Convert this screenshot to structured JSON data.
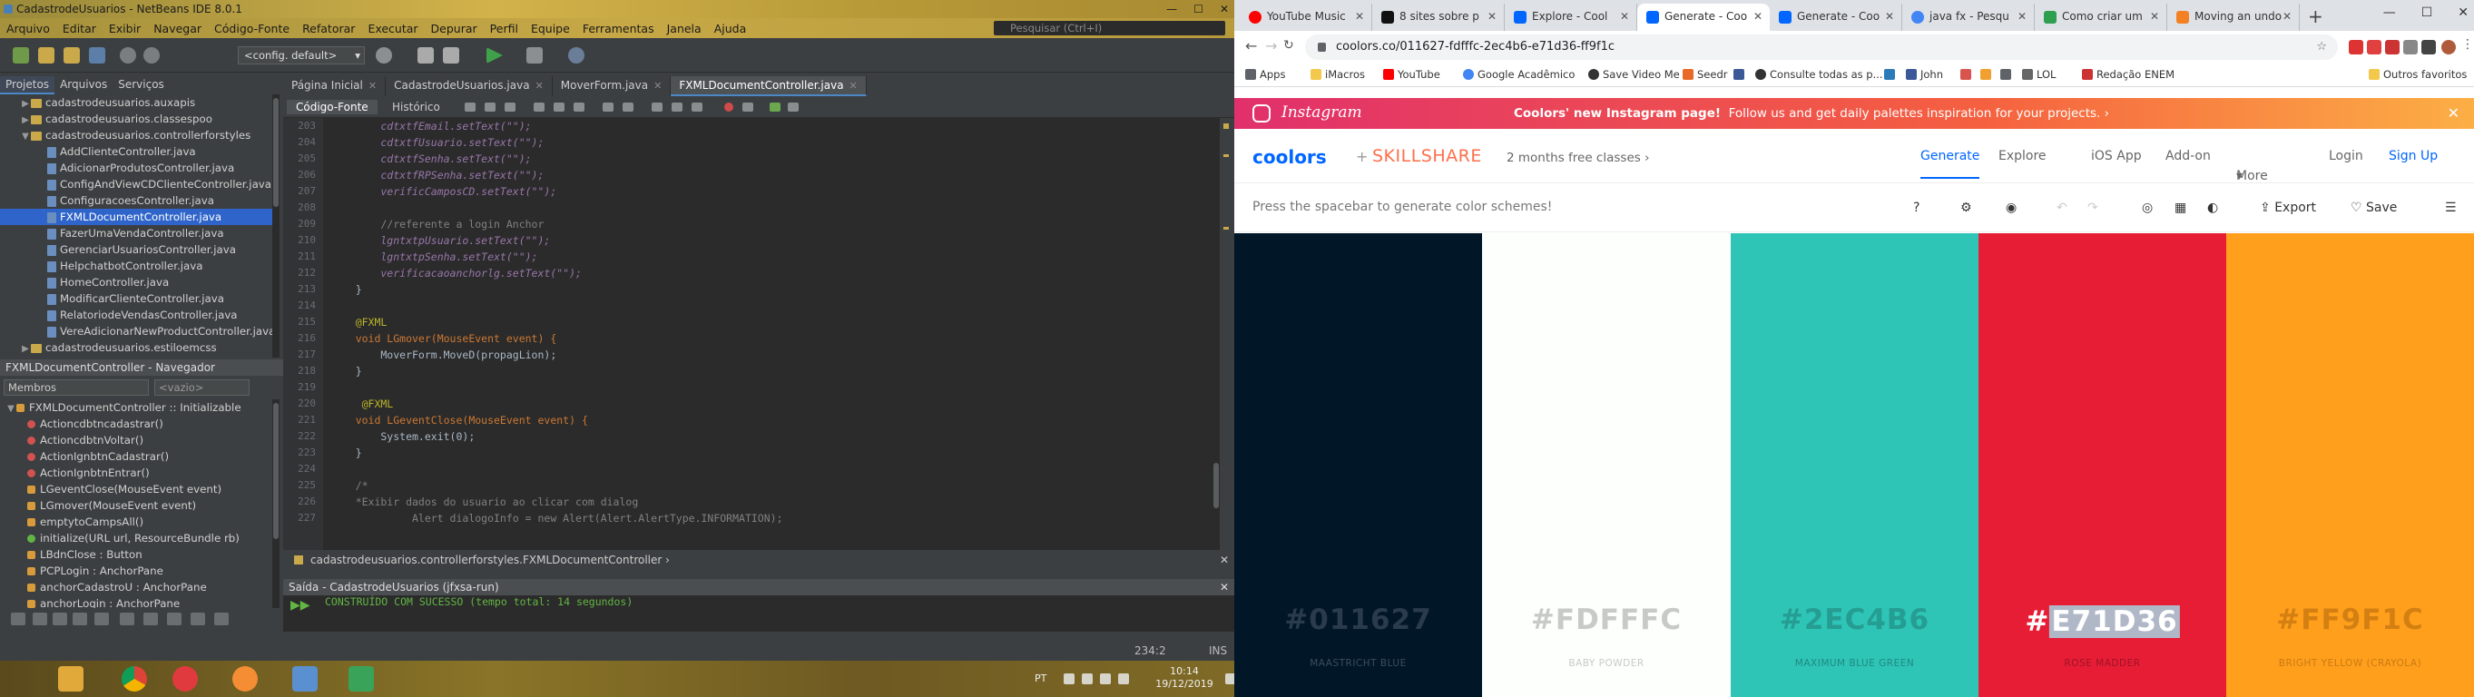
{
  "netbeans": {
    "title": "CadastrodeUsuarios - NetBeans IDE 8.0.1",
    "window_buttons": [
      "—",
      "☐",
      "✕"
    ],
    "menu": [
      "Arquivo",
      "Editar",
      "Exibir",
      "Navegar",
      "Código-Fonte",
      "Refatorar",
      "Executar",
      "Depurar",
      "Perfil",
      "Equipe",
      "Ferramentas",
      "Janela",
      "Ajuda"
    ],
    "search_placeholder": "Pesquisar (Ctrl+I)",
    "config": "<config. default>",
    "project_tabs": [
      "Projetos",
      "Arquivos",
      "Serviços"
    ],
    "project_tree": [
      {
        "label": "cadastrodeusuarios.auxapis",
        "kind": "package"
      },
      {
        "label": "cadastrodeusuarios.classespoo",
        "kind": "package"
      },
      {
        "label": "cadastrodeusuarios.controllerforstyles",
        "kind": "package"
      },
      {
        "label": "AddClienteController.java",
        "kind": "file"
      },
      {
        "label": "AdicionarProdutosController.java",
        "kind": "file"
      },
      {
        "label": "ConfigAndViewCDClienteController.java",
        "kind": "file"
      },
      {
        "label": "ConfiguracoesController.java",
        "kind": "file"
      },
      {
        "label": "FXMLDocumentController.java",
        "kind": "file"
      },
      {
        "label": "FazerUmaVendaController.java",
        "kind": "file"
      },
      {
        "label": "GerenciarUsuariosController.java",
        "kind": "file"
      },
      {
        "label": "HelpchatbotController.java",
        "kind": "file"
      },
      {
        "label": "HomeController.java",
        "kind": "file"
      },
      {
        "label": "ModificarClienteController.java",
        "kind": "file"
      },
      {
        "label": "RelatoriodeVendasController.java",
        "kind": "file"
      },
      {
        "label": "VereAdicionarNewProductController.java",
        "kind": "file"
      },
      {
        "label": "cadastrodeusuarios.estiloemcss",
        "kind": "package"
      }
    ],
    "navigator_title": "FXMLDocumentController - Navegador",
    "navigator_members": "Membros",
    "navigator_filter": "<vazio>",
    "navigator_items": [
      {
        "label": "FXMLDocumentController :: Initializable",
        "kind": "class"
      },
      {
        "label": "Actioncdbtncadastrar()",
        "kind": "private"
      },
      {
        "label": "ActioncdbtnVoltar()",
        "kind": "private"
      },
      {
        "label": "ActionIgnbtnCadastrar()",
        "kind": "private"
      },
      {
        "label": "ActionIgnbtnEntrar()",
        "kind": "private"
      },
      {
        "label": "LGeventClose(MouseEvent event)",
        "kind": "field"
      },
      {
        "label": "LGmover(MouseEvent event)",
        "kind": "field"
      },
      {
        "label": "emptytoCampsAll()",
        "kind": "field"
      },
      {
        "label": "initialize(URL url, ResourceBundle rb)",
        "kind": "public"
      },
      {
        "label": "LBdnClose : Button",
        "kind": "field"
      },
      {
        "label": "PCPLogin : AnchorPane",
        "kind": "field"
      },
      {
        "label": "anchorCadastroU : AnchorPane",
        "kind": "field"
      },
      {
        "label": "anchorLogin : AnchorPane",
        "kind": "field"
      }
    ],
    "editor_tabs": [
      "Página Inicial",
      "CadastrodeUsuarios.java",
      "MoverForm.java",
      "FXMLDocumentController.java"
    ],
    "editor_subtabs": [
      "Código-Fonte",
      "Histórico"
    ],
    "line_numbers": [
      "203",
      "204",
      "205",
      "206",
      "207",
      "208",
      "209",
      "210",
      "211",
      "212",
      "213",
      "214",
      "215",
      "216",
      "217",
      "218",
      "219",
      "220",
      "221",
      "222",
      "223",
      "224",
      "225",
      "226",
      "227"
    ],
    "code": [
      "        cdtxtfEmail.setText(\"\");",
      "        cdtxtfUsuario.setText(\"\");",
      "        cdtxtfSenha.setText(\"\");",
      "        cdtxtfRPSenha.setText(\"\");",
      "        verificCamposCD.setText(\"\");",
      "",
      "        //referente a login Anchor",
      "        lgntxtpUsuario.setText(\"\");",
      "        lgntxtpSenha.setText(\"\");",
      "        verificacaoanchorlg.setText(\"\");",
      "    }",
      "",
      "    @FXML",
      "    void LGmover(MouseEvent event) {",
      "        MoverForm.MoveD(propagLion);",
      "    }",
      "",
      "     @FXML",
      "    void LGeventClose(MouseEvent event) {",
      "        System.exit(0);",
      "    }",
      "",
      "    /*",
      "    *Exibir dados do usuario ao clicar com dialog",
      "             Alert dialogoInfo = new Alert(Alert.AlertType.INFORMATION);"
    ],
    "breadcrumb": "cadastrodeusuarios.controllerforstyles.FXMLDocumentController",
    "output_title": "Saída - CadastrodeUsuarios (jfxsa-run)",
    "output_text": "CONSTRUÍDO COM SUCESSO (tempo total: 14 segundos)",
    "status_position": "234:2",
    "status_mode": "INS"
  },
  "taskbar": {
    "language": "PT",
    "time": "10:14",
    "date": "19/12/2019"
  },
  "chrome": {
    "tabs": [
      {
        "title": "YouTube Music",
        "color": "#ff0000"
      },
      {
        "title": "8 sites sobre p",
        "color": "#111111"
      },
      {
        "title": "Explore - Cool",
        "color": "#0066ff"
      },
      {
        "title": "Generate - Coo",
        "color": "#0066ff",
        "active": true
      },
      {
        "title": "Generate - Coo",
        "color": "#0066ff"
      },
      {
        "title": "java fx - Pesqu",
        "color": "#4285f4"
      },
      {
        "title": "Como criar um",
        "color": "#2e9e4f"
      },
      {
        "title": "Moving an undo",
        "color": "#f48024"
      }
    ],
    "url": "coolors.co/011627-fdfffc-2ec4b6-e71d36-ff9f1c",
    "bookmarks": [
      "Apps",
      "iMacros",
      "YouTube",
      "Google Acadêmico",
      "Save Video Me",
      "Seedr",
      "Consulte todas as p...",
      "",
      "John",
      "",
      "",
      "",
      "LOL",
      "",
      "Redação ENEM",
      "Outros favoritos"
    ]
  },
  "coolors": {
    "banner_brand": "Instagram",
    "banner_bold": "Coolors' new Instagram page!",
    "banner_text": "Follow us and get daily palettes inspiration for your projects.",
    "logo": "coolors",
    "plus": "+",
    "partner": "SKILLSHARE",
    "promo": "2 months free classes",
    "nav": [
      "Generate",
      "Explore",
      "iOS App",
      "Add-on",
      "More",
      "Login",
      "Sign Up"
    ],
    "hint": "Press the spacebar to generate color schemes!",
    "export_label": "Export",
    "save_label": "Save",
    "palette": [
      {
        "hex": "011627",
        "color": "#011627",
        "name": "Maastricht Blue"
      },
      {
        "hex": "FDFFFC",
        "color": "#FDFFFC",
        "name": "Baby Powder"
      },
      {
        "hex": "2EC4B6",
        "color": "#2EC4B6",
        "name": "Maximum Blue Green"
      },
      {
        "hex": "E71D36",
        "color": "#E71D36",
        "name": "Rose Madder"
      },
      {
        "hex": "FF9F1C",
        "color": "#FF9F1C",
        "name": "Bright Yellow (Crayola)"
      }
    ]
  }
}
